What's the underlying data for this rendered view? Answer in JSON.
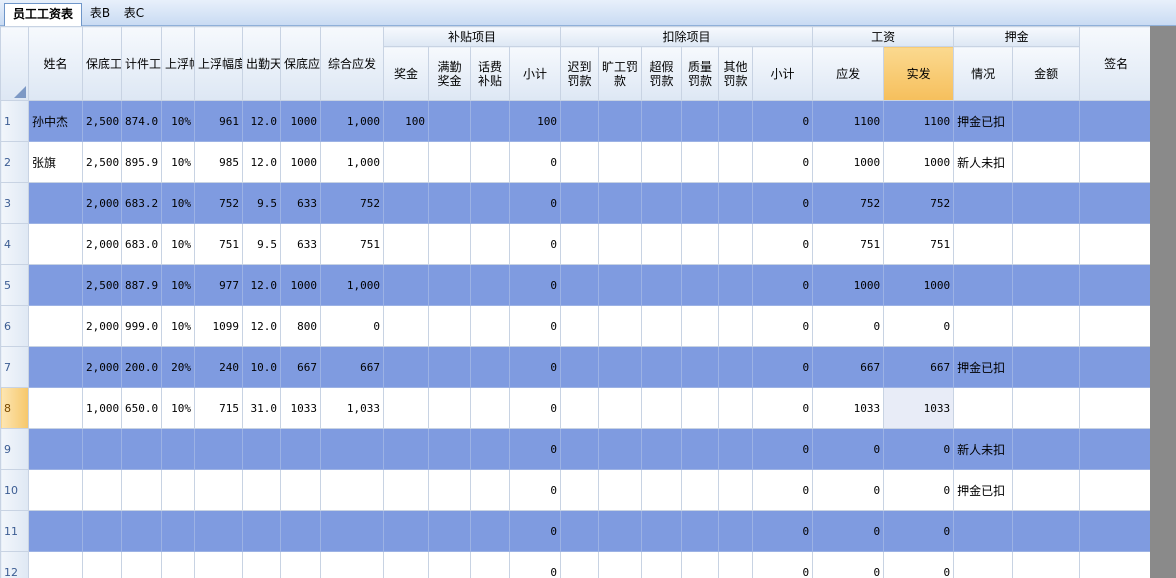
{
  "tabs": [
    {
      "label": "员工工资表",
      "active": true
    },
    {
      "label": "表B",
      "active": false
    },
    {
      "label": "表C",
      "active": false
    }
  ],
  "header": {
    "groups": {
      "subsidy": "补贴项目",
      "deduction": "扣除项目",
      "wage": "工资",
      "deposit": "押金"
    },
    "columns": {
      "name": "姓名",
      "base_wage": "保底工资",
      "piece_wage": "计件工资",
      "float_rate": "上浮幅度",
      "float_wage": "上浮幅度工资",
      "attendance": "出勤天数",
      "base_payable": "保底应发",
      "total_payable": "综合应发",
      "bonus": "奖金",
      "full_attendance": "满勤奖金",
      "phone_subsidy": "话费补贴",
      "subsidy_subtotal": "小计",
      "late_fine": "迟到罚款",
      "absent_fine": "旷工罚款",
      "overleave_fine": "超假罚款",
      "quality_fine": "质量罚款",
      "other_fine": "其他罚款",
      "deduction_subtotal": "小计",
      "payable": "应发",
      "actual": "实发",
      "deposit_status": "情况",
      "deposit_amount": "金额",
      "signature": "签名"
    }
  },
  "rows": [
    {
      "n": "1",
      "name": "孙中杰",
      "base": "2,500",
      "piece": "874.0",
      "rate": "10%",
      "fw": "961",
      "days": "12.0",
      "bp": "1000",
      "total": "1,000",
      "bonus": "100",
      "full": "",
      "phone": "",
      "ssub": "100",
      "late": "",
      "absent": "",
      "over": "",
      "quality": "",
      "other": "",
      "dsub": "0",
      "payable": "1100",
      "actual": "1100",
      "dstatus": "押金已扣",
      "damount": "",
      "sign": ""
    },
    {
      "n": "2",
      "name": "张旗",
      "base": "2,500",
      "piece": "895.9",
      "rate": "10%",
      "fw": "985",
      "days": "12.0",
      "bp": "1000",
      "total": "1,000",
      "bonus": "",
      "full": "",
      "phone": "",
      "ssub": "0",
      "late": "",
      "absent": "",
      "over": "",
      "quality": "",
      "other": "",
      "dsub": "0",
      "payable": "1000",
      "actual": "1000",
      "dstatus": "新人未扣",
      "damount": "",
      "sign": ""
    },
    {
      "n": "3",
      "name": "",
      "base": "2,000",
      "piece": "683.2",
      "rate": "10%",
      "fw": "752",
      "days": "9.5",
      "bp": "633",
      "total": "752",
      "bonus": "",
      "full": "",
      "phone": "",
      "ssub": "0",
      "late": "",
      "absent": "",
      "over": "",
      "quality": "",
      "other": "",
      "dsub": "0",
      "payable": "752",
      "actual": "752",
      "dstatus": "",
      "damount": "",
      "sign": ""
    },
    {
      "n": "4",
      "name": "",
      "base": "2,000",
      "piece": "683.0",
      "rate": "10%",
      "fw": "751",
      "days": "9.5",
      "bp": "633",
      "total": "751",
      "bonus": "",
      "full": "",
      "phone": "",
      "ssub": "0",
      "late": "",
      "absent": "",
      "over": "",
      "quality": "",
      "other": "",
      "dsub": "0",
      "payable": "751",
      "actual": "751",
      "dstatus": "",
      "damount": "",
      "sign": ""
    },
    {
      "n": "5",
      "name": "",
      "base": "2,500",
      "piece": "887.9",
      "rate": "10%",
      "fw": "977",
      "days": "12.0",
      "bp": "1000",
      "total": "1,000",
      "bonus": "",
      "full": "",
      "phone": "",
      "ssub": "0",
      "late": "",
      "absent": "",
      "over": "",
      "quality": "",
      "other": "",
      "dsub": "0",
      "payable": "1000",
      "actual": "1000",
      "dstatus": "",
      "damount": "",
      "sign": ""
    },
    {
      "n": "6",
      "name": "",
      "base": "2,000",
      "piece": "999.0",
      "rate": "10%",
      "fw": "1099",
      "days": "12.0",
      "bp": "800",
      "total": "0",
      "bonus": "",
      "full": "",
      "phone": "",
      "ssub": "0",
      "late": "",
      "absent": "",
      "over": "",
      "quality": "",
      "other": "",
      "dsub": "0",
      "payable": "0",
      "actual": "0",
      "dstatus": "",
      "damount": "",
      "sign": ""
    },
    {
      "n": "7",
      "name": "",
      "base": "2,000",
      "piece": "200.0",
      "rate": "20%",
      "fw": "240",
      "days": "10.0",
      "bp": "667",
      "total": "667",
      "bonus": "",
      "full": "",
      "phone": "",
      "ssub": "0",
      "late": "",
      "absent": "",
      "over": "",
      "quality": "",
      "other": "",
      "dsub": "0",
      "payable": "667",
      "actual": "667",
      "dstatus": "押金已扣",
      "damount": "",
      "sign": ""
    },
    {
      "n": "8",
      "name": "",
      "base": "1,000",
      "piece": "650.0",
      "rate": "10%",
      "fw": "715",
      "days": "31.0",
      "bp": "1033",
      "total": "1,033",
      "bonus": "",
      "full": "",
      "phone": "",
      "ssub": "0",
      "late": "",
      "absent": "",
      "over": "",
      "quality": "",
      "other": "",
      "dsub": "0",
      "payable": "1033",
      "actual": "1033",
      "dstatus": "",
      "damount": "",
      "sign": ""
    },
    {
      "n": "9",
      "name": "",
      "base": "",
      "piece": "",
      "rate": "",
      "fw": "",
      "days": "",
      "bp": "",
      "total": "",
      "bonus": "",
      "full": "",
      "phone": "",
      "ssub": "0",
      "late": "",
      "absent": "",
      "over": "",
      "quality": "",
      "other": "",
      "dsub": "0",
      "payable": "0",
      "actual": "0",
      "dstatus": "新人未扣",
      "damount": "",
      "sign": ""
    },
    {
      "n": "10",
      "name": "",
      "base": "",
      "piece": "",
      "rate": "",
      "fw": "",
      "days": "",
      "bp": "",
      "total": "",
      "bonus": "",
      "full": "",
      "phone": "",
      "ssub": "0",
      "late": "",
      "absent": "",
      "over": "",
      "quality": "",
      "other": "",
      "dsub": "0",
      "payable": "0",
      "actual": "0",
      "dstatus": "押金已扣",
      "damount": "",
      "sign": ""
    },
    {
      "n": "11",
      "name": "",
      "base": "",
      "piece": "",
      "rate": "",
      "fw": "",
      "days": "",
      "bp": "",
      "total": "",
      "bonus": "",
      "full": "",
      "phone": "",
      "ssub": "0",
      "late": "",
      "absent": "",
      "over": "",
      "quality": "",
      "other": "",
      "dsub": "0",
      "payable": "0",
      "actual": "0",
      "dstatus": "",
      "damount": "",
      "sign": ""
    },
    {
      "n": "12",
      "name": "",
      "base": "",
      "piece": "",
      "rate": "",
      "fw": "",
      "days": "",
      "bp": "",
      "total": "",
      "bonus": "",
      "full": "",
      "phone": "",
      "ssub": "0",
      "late": "",
      "absent": "",
      "over": "",
      "quality": "",
      "other": "",
      "dsub": "0",
      "payable": "0",
      "actual": "0",
      "dstatus": "",
      "damount": "",
      "sign": ""
    }
  ],
  "colors": {
    "band": "#7f9be0",
    "selected_header": "#f6bf5c",
    "header_bg": "#dde7f4"
  },
  "selection": {
    "row": "8",
    "column": "实发"
  }
}
